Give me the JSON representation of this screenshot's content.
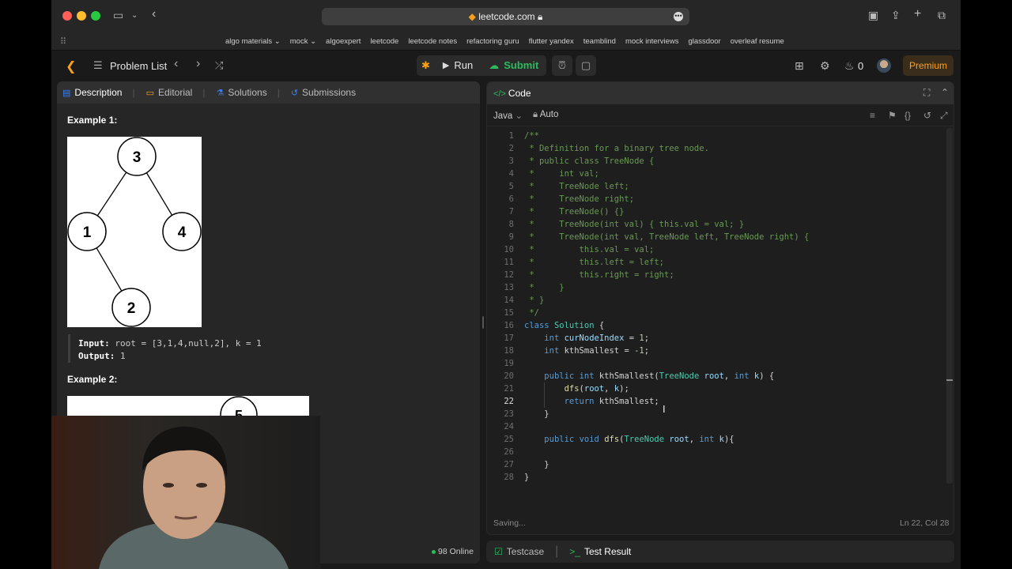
{
  "browser": {
    "url": "leetcode.com",
    "bookmarks": [
      "algo materials ⌄",
      "mock ⌄",
      "algoexpert",
      "leetcode",
      "leetcode notes",
      "refactoring guru",
      "flutter yandex",
      "teamblind",
      "mock interviews",
      "glassdoor",
      "overleaf resume"
    ]
  },
  "nav": {
    "problem_list": "Problem List",
    "run": "Run",
    "submit": "Submit",
    "streak": "0",
    "premium": "Premium"
  },
  "left": {
    "tabs": [
      "Description",
      "Editorial",
      "Solutions",
      "Submissions"
    ],
    "example1_title": "Example 1:",
    "tree1_nodes": [
      "3",
      "1",
      "4",
      "2"
    ],
    "input_label": "Input:",
    "input_value": "root = [3,1,4,null,2], k = 1",
    "output_label": "Output:",
    "output_value": "1",
    "example2_title": "Example 2:",
    "tree2_node": "5",
    "online": "98 Online"
  },
  "right": {
    "code_tab": "Code",
    "language": "Java",
    "auto": "Auto",
    "saving": "Saving...",
    "position": "Ln 22, Col 28",
    "current_line": 22,
    "bottom_tabs": [
      "Testcase",
      "Test Result"
    ]
  },
  "code_lines": [
    "/**",
    " * Definition for a binary tree node.",
    " * public class TreeNode {",
    " *     int val;",
    " *     TreeNode left;",
    " *     TreeNode right;",
    " *     TreeNode() {}",
    " *     TreeNode(int val) { this.val = val; }",
    " *     TreeNode(int val, TreeNode left, TreeNode right) {",
    " *         this.val = val;",
    " *         this.left = left;",
    " *         this.right = right;",
    " *     }",
    " * }",
    " */",
    "class Solution {",
    "    int curNodeIndex = 1;",
    "    int kthSmallest = -1;",
    "",
    "    public int kthSmallest(TreeNode root, int k) {",
    "        dfs(root, k);",
    "        return kthSmallest;",
    "    }",
    "",
    "    public void dfs(TreeNode root, int k){",
    "",
    "    }",
    "}"
  ]
}
